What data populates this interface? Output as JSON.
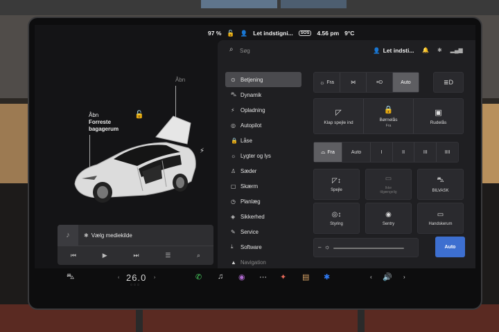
{
  "status_bar": {
    "battery": "97 %",
    "profile": "Let indstigni...",
    "sos": "SOS",
    "time": "4.56 pm",
    "temperature": "9°C"
  },
  "car": {
    "frunk_label_1": "Åbn",
    "frunk_label_2": "Forreste",
    "frunk_label_3": "bagagerum",
    "trunk_label": "Åbn"
  },
  "media": {
    "source_label": "Vælg mediekilde"
  },
  "panel": {
    "search_placeholder": "Søg",
    "profile": "Let indsti..."
  },
  "menu": [
    {
      "label": "Betjening",
      "icon": "toggle-icon",
      "glyph": "⊙"
    },
    {
      "label": "Dynamik",
      "icon": "car-icon",
      "glyph": "⛍"
    },
    {
      "label": "Opladning",
      "icon": "charging-icon",
      "glyph": "⚡"
    },
    {
      "label": "Autopilot",
      "icon": "steering-wheel-icon",
      "glyph": "◎"
    },
    {
      "label": "Låse",
      "icon": "lock-icon",
      "glyph": "🔒"
    },
    {
      "label": "Lygter og lys",
      "icon": "sun-icon",
      "glyph": "☼"
    },
    {
      "label": "Sæder",
      "icon": "seat-icon",
      "glyph": "♙"
    },
    {
      "label": "Skærm",
      "icon": "display-icon",
      "glyph": "▢"
    },
    {
      "label": "Planlæg",
      "icon": "clock-icon",
      "glyph": "◷"
    },
    {
      "label": "Sikkerhed",
      "icon": "shield-icon",
      "glyph": "◈"
    },
    {
      "label": "Service",
      "icon": "wrench-icon",
      "glyph": "✎"
    },
    {
      "label": "Software",
      "icon": "download-icon",
      "glyph": "⤓"
    },
    {
      "label": "Navigation",
      "icon": "navigation-icon",
      "glyph": "▲"
    }
  ],
  "lights": {
    "off": "Fra",
    "auto": "Auto"
  },
  "quick": {
    "mirror_fold": "Klap spejle ind",
    "child_lock": "Børnelås",
    "child_lock_state": "Fra",
    "window_lock": "Rudelås"
  },
  "wipers": {
    "off": "Fra",
    "auto": "Auto",
    "speeds": [
      "I",
      "II",
      "III",
      "IIII"
    ]
  },
  "controls": {
    "mirrors": "Spejle",
    "unavailable_1": "Ikke",
    "unavailable_2": "tilgængelig",
    "carwash": "BILVASK",
    "steering": "Styring",
    "sentry": "Sentry",
    "glovebox": "Handskerum"
  },
  "brightness": {
    "level": 0.85,
    "auto": "Auto"
  },
  "dock": {
    "temperature": "26.0"
  },
  "colors": {
    "accent_blue": "#3d6fd0",
    "panel_bg": "#1f1f22",
    "screen_bg": "#141416"
  }
}
